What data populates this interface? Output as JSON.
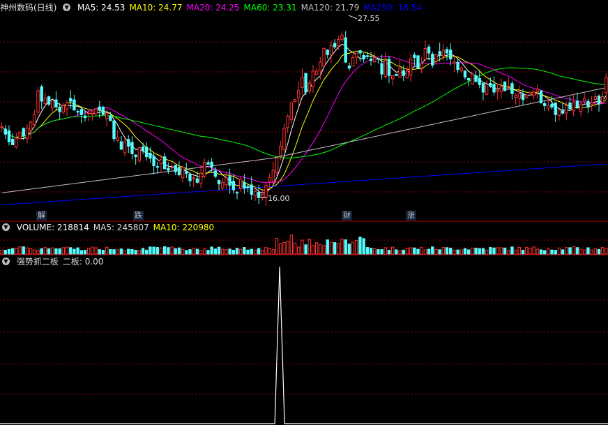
{
  "stock": {
    "title": "神州数码(日线)"
  },
  "main_indicators": [
    {
      "label": "MA5: 24.53",
      "color": "#ffffff"
    },
    {
      "label": "MA10: 24.77",
      "color": "#ffff00"
    },
    {
      "label": "MA20: 24.25",
      "color": "#ff00ff"
    },
    {
      "label": "MA60: 23.31",
      "color": "#00ff00"
    },
    {
      "label": "MA120: 21.79",
      "color": "#c0c0c0"
    },
    {
      "label": "MA250: 18.54",
      "color": "#0000ff"
    }
  ],
  "price_marks": {
    "high": "27.55",
    "low": "16.00"
  },
  "event_tags": [
    {
      "text": "解",
      "color": "#dcdcdc"
    },
    {
      "text": "跌",
      "color": "#00ff00"
    },
    {
      "text": "财",
      "color": "#dcdcdc"
    },
    {
      "text": "涨",
      "color": "#ff4040"
    }
  ],
  "volume_header": [
    {
      "label": "VOLUME: 218814",
      "color": "#ffffff"
    },
    {
      "label": "MA5: 245807",
      "color": "#dcdcdc"
    },
    {
      "label": "MA10: 220980",
      "color": "#ffff00"
    }
  ],
  "indicator_header": [
    {
      "label": "强势抓二板",
      "color": "#dcdcdc"
    },
    {
      "label": "二板: 0.00",
      "color": "#dcdcdc"
    }
  ],
  "colors": {
    "up": "#ff3232",
    "down": "#54fcfc",
    "grid": "#8b0000",
    "border": "#b00000",
    "signal": "#ffffff"
  },
  "chart_data": {
    "type": "candlestick",
    "price_range": [
      15.5,
      28.5
    ],
    "closes": [
      21.0,
      20.5,
      20.0,
      19.8,
      20.2,
      20.6,
      20.4,
      20.9,
      21.3,
      21.8,
      23.4,
      22.7,
      22.9,
      22.5,
      22.7,
      22.3,
      22.0,
      22.4,
      22.6,
      22.7,
      22.1,
      22.0,
      21.8,
      21.6,
      21.9,
      22.0,
      22.2,
      22.1,
      21.8,
      21.9,
      21.4,
      20.2,
      20.3,
      19.5,
      20.0,
      19.7,
      19.2,
      19.0,
      19.6,
      19.4,
      19.0,
      18.9,
      18.4,
      18.3,
      18.8,
      18.2,
      18.1,
      18.3,
      18.0,
      17.8,
      18.3,
      17.9,
      17.4,
      17.6,
      17.3,
      17.9,
      18.6,
      18.5,
      18.3,
      17.7,
      17.2,
      17.3,
      17.6,
      17.1,
      16.8,
      16.6,
      17.5,
      16.9,
      17.0,
      16.5,
      16.7,
      16.3,
      16.5,
      17.1,
      17.6,
      18.1,
      18.9,
      19.7,
      20.9,
      21.7,
      22.6,
      22.8,
      23.4,
      24.3,
      23.3,
      23.9,
      24.7,
      24.7,
      25.3,
      26.2,
      25.8,
      26.4,
      26.3,
      26.8,
      27.1,
      25.3,
      24.9,
      25.6,
      25.9,
      25.9,
      25.5,
      25.7,
      25.4,
      25.6,
      25.5,
      24.5,
      25.4,
      24.4,
      24.4,
      24.4,
      24.9,
      24.4,
      24.7,
      25.5,
      25.6,
      24.9,
      25.2,
      26.2,
      25.9,
      25.1,
      25.8,
      25.8,
      26.1,
      25.9,
      25.5,
      25.3,
      24.8,
      24.9,
      24.3,
      24.1,
      24.5,
      24.0,
      23.8,
      23.3,
      23.8,
      23.7,
      23.3,
      23.4,
      23.7,
      23.4,
      23.7,
      23.2,
      23.1,
      23.2,
      22.8,
      23.1,
      23.3,
      23.3,
      23.5,
      22.6,
      22.4,
      22.4,
      22.3,
      21.8,
      22.1,
      21.9,
      22.4,
      22.2,
      22.6,
      22.3,
      22.5,
      22.9,
      22.3,
      22.6,
      23.0,
      22.5,
      23.0,
      24.3
    ],
    "ma_legend": [
      "MA5",
      "MA10",
      "MA20",
      "MA60",
      "MA120",
      "MA250"
    ],
    "volume_range": [
      0,
      900000
    ],
    "signal_values": [
      {
        "x_fraction": 0.46,
        "value": 1
      },
      {
        "x_fraction": 0.47,
        "value": 0
      }
    ]
  }
}
